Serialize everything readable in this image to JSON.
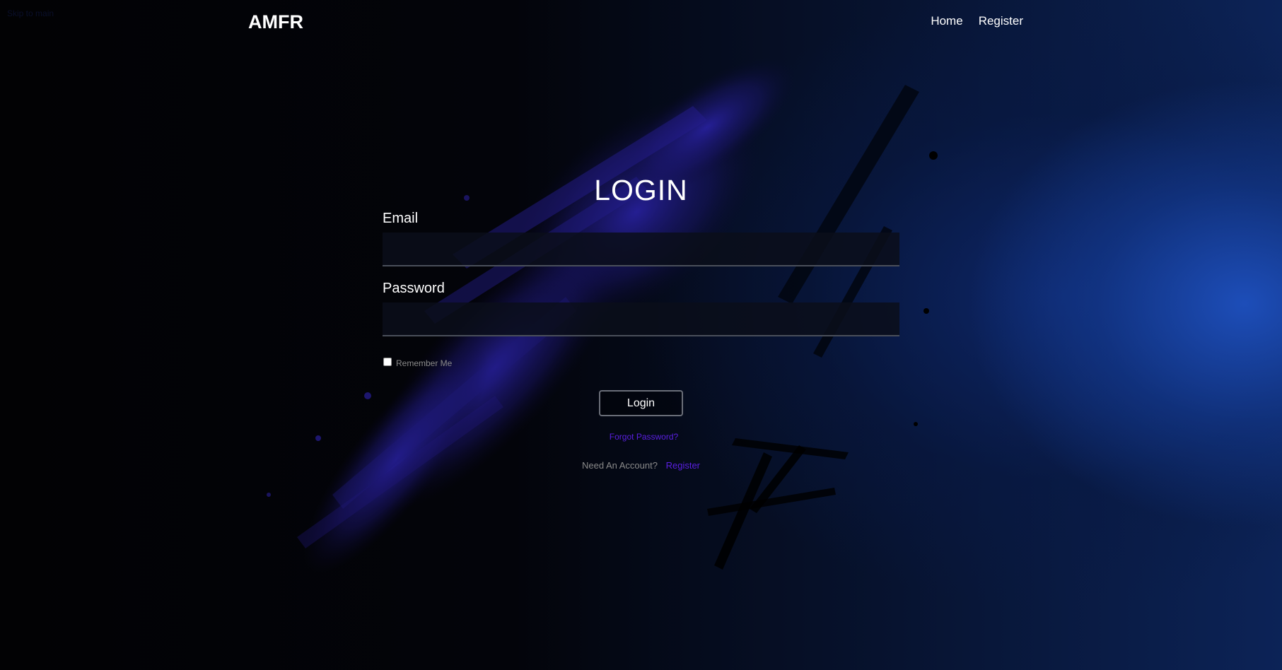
{
  "nav": {
    "skip_text": "Skip to main",
    "brand": "AMFR",
    "links": [
      "Home",
      "Register"
    ]
  },
  "form": {
    "title": "LOGIN",
    "email_label": "Email",
    "email_value": "",
    "password_label": "Password",
    "password_value": "",
    "remember_label": "Remember Me",
    "remember_checked": false,
    "login_button": "Login",
    "forgot_link": "Forgot Password?",
    "need_account_text": "Need An Account?",
    "register_link": "Register"
  },
  "colors": {
    "accent_link": "#5a1fe0",
    "splash": "#2a1f9a",
    "glow": "#1e50be"
  },
  "icons": {
    "remember_checkbox": "checkbox-icon"
  }
}
